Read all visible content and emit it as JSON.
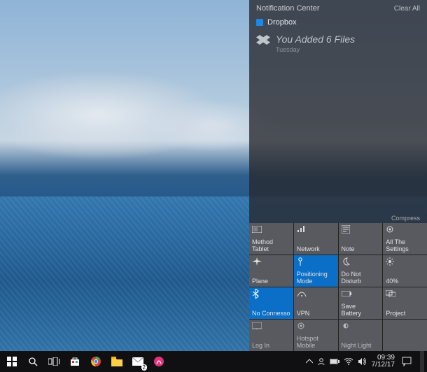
{
  "panel": {
    "title": "Notification Center",
    "clear_label": "Clear All",
    "compress_label": "Compress"
  },
  "notification": {
    "app_name": "Dropbox",
    "headline": "You Added 6 Files",
    "timestamp": "Tuesday"
  },
  "quick_actions": [
    {
      "id": "tablet",
      "label": "Method\nTablet",
      "active": false
    },
    {
      "id": "network",
      "label": "Network",
      "active": false
    },
    {
      "id": "note",
      "label": "Note",
      "active": false
    },
    {
      "id": "settings",
      "label": "All The\nSettings",
      "active": false
    },
    {
      "id": "airplane",
      "label": "Plane",
      "active": false
    },
    {
      "id": "position",
      "label": "Positioning Mode",
      "active": true
    },
    {
      "id": "dnd",
      "label": "Do Not Disturb",
      "active": false
    },
    {
      "id": "brightness",
      "label": "40%",
      "active": false
    },
    {
      "id": "bluetooth",
      "label": "No Connesso",
      "active": true
    },
    {
      "id": "vpn",
      "label": "VPN",
      "active": false
    },
    {
      "id": "save",
      "label": "Save\nBattery",
      "active": false
    },
    {
      "id": "project",
      "label": "Project",
      "active": false
    },
    {
      "id": "login",
      "label": "Log In",
      "active": false
    },
    {
      "id": "hotspot",
      "label": "Hotspot\nMobile",
      "active": false
    },
    {
      "id": "nightlight",
      "label": "Night Light",
      "active": false
    }
  ],
  "taskbar": {
    "time": "09:39",
    "date": "7/12/17"
  },
  "colors": {
    "accent": "#0b6fc7",
    "panel_bg": "rgba(40,40,45,.78)",
    "tile_bg": "#585a5f"
  }
}
